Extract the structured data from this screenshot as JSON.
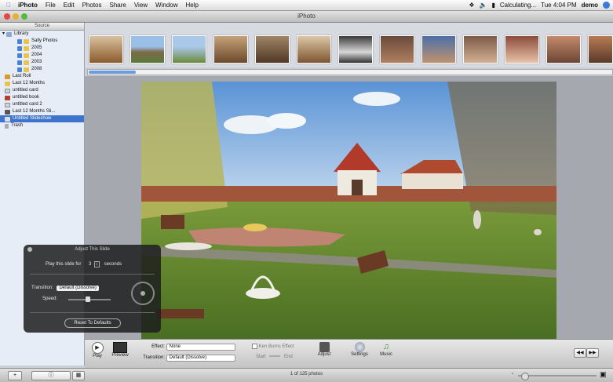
{
  "menubar": {
    "app": "iPhoto",
    "items": [
      "File",
      "Edit",
      "Photos",
      "Share",
      "View",
      "Window",
      "Help"
    ],
    "status_right": "Calculating...",
    "clock": "Tue 4:04 PM",
    "user": "demo"
  },
  "window": {
    "title": "iPhoto"
  },
  "sidebar": {
    "header": "Source",
    "items": [
      {
        "label": "Library",
        "kind": "library"
      },
      {
        "label": "Sally Photos",
        "kind": "year"
      },
      {
        "label": "2005",
        "kind": "year"
      },
      {
        "label": "2004",
        "kind": "year"
      },
      {
        "label": "2003",
        "kind": "year"
      },
      {
        "label": "2008",
        "kind": "year"
      },
      {
        "label": "Last Roll",
        "kind": "roll"
      },
      {
        "label": "Last 12 Months",
        "kind": "album"
      },
      {
        "label": "untitled card",
        "kind": "card"
      },
      {
        "label": "untitled book",
        "kind": "book"
      },
      {
        "label": "untitled card 2",
        "kind": "card"
      },
      {
        "label": "Last 12 Months Sli...",
        "kind": "slideshow"
      },
      {
        "label": "Untitled Slideshow",
        "kind": "slideshow",
        "selected": true
      },
      {
        "label": "Trash",
        "kind": "trash"
      }
    ]
  },
  "hud": {
    "title": "Adjust This Slide",
    "play_label": "Play this slide for",
    "seconds_value": "3",
    "seconds_unit": "seconds",
    "transition_label": "Transition:",
    "transition_value": "Default (Dissolve)",
    "speed_label": "Speed:",
    "speed_level": 0.45,
    "reset_label": "Reset To Defaults"
  },
  "toolbar": {
    "play_label": "Play",
    "preview_label": "Preview",
    "effect_label": "Effect:",
    "effect_value": "None",
    "transition_label": "Transition:",
    "transition_value": "Default (Dissolve)",
    "ken_burns_label": "Ken Burns Effect",
    "start_label": "Start",
    "end_label": "End",
    "adjust_label": "Adjust",
    "settings_label": "Settings",
    "music_label": "Music"
  },
  "statusbar": {
    "count": "1 of 125 photos"
  },
  "colors": {
    "selection": "#3f74cc",
    "sidebar_bg": "#e6edf6",
    "hud_bg": "#1e1e1e"
  }
}
